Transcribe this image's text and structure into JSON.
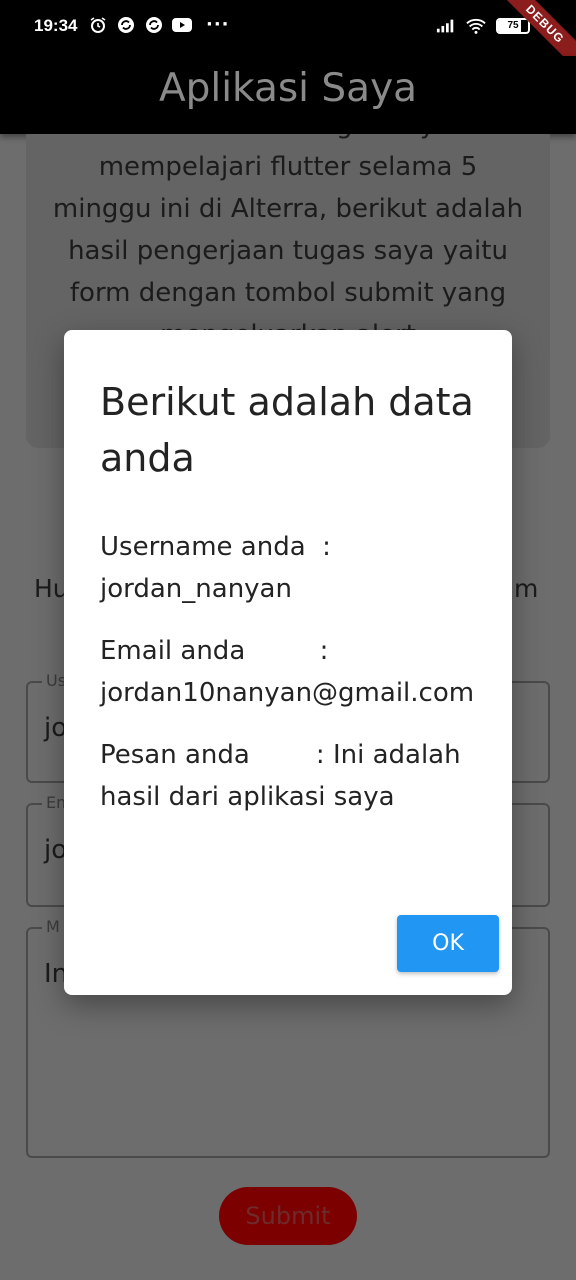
{
  "status_bar": {
    "time": "19:34",
    "more": "···",
    "battery_level": "75",
    "debug_label": "DEBUG",
    "icons": [
      "alarm-icon",
      "sync-icon",
      "sync-icon",
      "youtube-icon",
      "signal-icon",
      "wifi-icon",
      "battery-icon"
    ]
  },
  "app_bar": {
    "title": "Aplikasi Saya"
  },
  "background_page": {
    "info_text": "...erikut ini adalah tugas saya dari mempelajari flutter selama 5 minggu ini di Alterra, berikut adalah hasil pengerjaan tugas saya yaitu form dengan tombol submit yang mengeluarkan alert",
    "hu_left": "Hu",
    "hu_right": "m",
    "fields": [
      {
        "label": "Us",
        "value": "jo"
      },
      {
        "label": "Em",
        "value": "jo"
      },
      {
        "label": "M",
        "value": "In"
      }
    ],
    "submit_label": "Submit"
  },
  "dialog": {
    "title": "Berikut adalah data anda",
    "username_row": "Username anda  : jordan_nanyan",
    "email_row": "Email anda         : jordan10nanyan@gmail.com",
    "message_row": "Pesan anda        : Ini adalah hasil dari aplikasi saya",
    "ok_label": "OK"
  },
  "colors": {
    "accent": "#2196f3",
    "submit": "#7c0000",
    "scrim": "#6d6d6d"
  }
}
